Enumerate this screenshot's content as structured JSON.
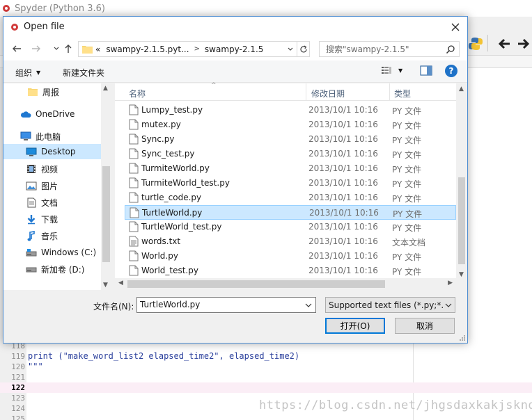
{
  "spyder": {
    "title": "Spyder (Python 3.6)",
    "code_lines": [
      {
        "num": "118",
        "text": "",
        "current": false
      },
      {
        "num": "119",
        "text": "print (\"make_word_list2 elapsed_time2\", elapsed_time2)",
        "current": false
      },
      {
        "num": "120",
        "text": "\"\"\"",
        "current": false
      },
      {
        "num": "121",
        "text": "",
        "current": false
      },
      {
        "num": "122",
        "text": "",
        "current": true
      },
      {
        "num": "123",
        "text": "",
        "current": false
      },
      {
        "num": "124",
        "text": "",
        "current": false
      },
      {
        "num": "125",
        "text": "",
        "current": false
      }
    ],
    "watermark": "https://blog.csdn.net/jhgsdaxkakjskndf"
  },
  "dialog": {
    "title": "Open file",
    "address": {
      "crumb_prefix": "«",
      "crumbs": [
        "swampy-2.1.5.pyt...",
        "swampy-2.1.5"
      ]
    },
    "search_placeholder": "搜索\"swampy-2.1.5\"",
    "toolbar": {
      "organize": "组织",
      "new_folder": "新建文件夹"
    },
    "nav_items": [
      {
        "label": "周报",
        "icon": "folder-icon"
      },
      {
        "label": "OneDrive",
        "icon": "cloud-icon"
      },
      {
        "label": "此电脑",
        "icon": "computer-icon"
      },
      {
        "label": "Desktop",
        "icon": "desktop-icon",
        "selected": true
      },
      {
        "label": "视频",
        "icon": "video-icon"
      },
      {
        "label": "图片",
        "icon": "pictures-icon"
      },
      {
        "label": "文档",
        "icon": "documents-icon"
      },
      {
        "label": "下载",
        "icon": "download-icon"
      },
      {
        "label": "音乐",
        "icon": "music-icon"
      },
      {
        "label": "Windows (C:)",
        "icon": "drive-c-icon"
      },
      {
        "label": "新加卷 (D:)",
        "icon": "drive-d-icon"
      }
    ],
    "columns": {
      "name": "名称",
      "date": "修改日期",
      "type": "类型"
    },
    "files": [
      {
        "name": "Lumpy_test.py",
        "date": "2013/10/1 10:16",
        "type": "PY 文件"
      },
      {
        "name": "mutex.py",
        "date": "2013/10/1 10:16",
        "type": "PY 文件"
      },
      {
        "name": "Sync.py",
        "date": "2013/10/1 10:16",
        "type": "PY 文件"
      },
      {
        "name": "Sync_test.py",
        "date": "2013/10/1 10:16",
        "type": "PY 文件"
      },
      {
        "name": "TurmiteWorld.py",
        "date": "2013/10/1 10:16",
        "type": "PY 文件"
      },
      {
        "name": "TurmiteWorld_test.py",
        "date": "2013/10/1 10:16",
        "type": "PY 文件"
      },
      {
        "name": "turtle_code.py",
        "date": "2013/10/1 10:16",
        "type": "PY 文件"
      },
      {
        "name": "TurtleWorld.py",
        "date": "2013/10/1 10:16",
        "type": "PY 文件",
        "selected": true
      },
      {
        "name": "TurtleWorld_test.py",
        "date": "2013/10/1 10:16",
        "type": "PY 文件"
      },
      {
        "name": "words.txt",
        "date": "2013/10/1 10:16",
        "type": "文本文档"
      },
      {
        "name": "World.py",
        "date": "2013/10/1 10:16",
        "type": "PY 文件"
      },
      {
        "name": "World_test.py",
        "date": "2013/10/1 10:16",
        "type": "PY 文件"
      }
    ],
    "filename_label": "文件名(N):",
    "filename_value": "TurtleWorld.py",
    "filter_value": "Supported text files (*.py;*.R",
    "open_label": "打开(O)",
    "cancel_label": "取消"
  }
}
